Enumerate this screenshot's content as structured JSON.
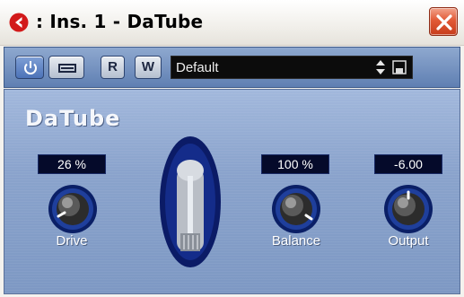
{
  "window": {
    "title": ": Ins. 1 - DaTube",
    "icons": {
      "app": "cubase-icon",
      "close": "close-icon"
    }
  },
  "toolbar": {
    "power_icon": "power-icon",
    "bypass_icon": "bypass-icon",
    "read_label": "R",
    "write_label": "W",
    "preset_value": "Default",
    "preset_arrows_icon": "up-down-arrows-icon",
    "save_icon": "save-icon"
  },
  "plugin": {
    "name": "DaTube",
    "controls": [
      {
        "label": "Drive",
        "readout": "26 %",
        "level": 0.26
      },
      {
        "label": "Balance",
        "readout": "100 %",
        "level": 1.0
      },
      {
        "label": "Output",
        "readout": "-6.00",
        "level": 0.5
      }
    ]
  },
  "colors": {
    "panel": "#8aa3cc",
    "readout_bg": "#050a2a",
    "knob_ring": "#1e3a8a",
    "close_button": "#e25a36"
  }
}
